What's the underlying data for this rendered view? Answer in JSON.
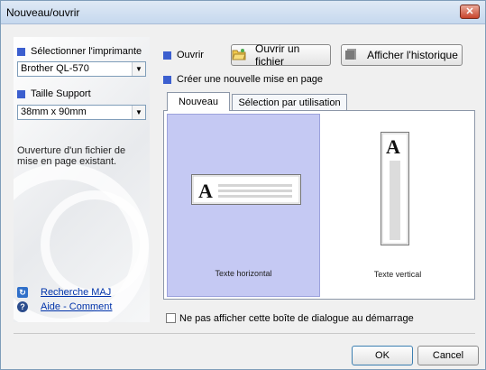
{
  "window": {
    "title": "Nouveau/ouvrir",
    "close_glyph": "✕"
  },
  "left": {
    "printer_label": "Sélectionner l'imprimante",
    "printer_value": "Brother QL-570",
    "media_label": "Taille Support",
    "media_value": "38mm x 90mm",
    "description": "Ouverture d'un fichier de mise en page existant.",
    "links": [
      {
        "label": "Recherche MAJ",
        "icon": "update-icon"
      },
      {
        "label": "Aide - Comment",
        "icon": "help-icon"
      }
    ]
  },
  "open": {
    "label": "Ouvrir",
    "open_file_button": "Ouvrir un fichier",
    "history_button": "Afficher l'historique"
  },
  "create": {
    "label": "Créer une nouvelle mise en page"
  },
  "tabs": [
    {
      "label": "Nouveau",
      "active": true
    },
    {
      "label": "Sélection par utilisation",
      "active": false
    }
  ],
  "layouts": {
    "horizontal_label": "Texte horizontal",
    "vertical_label": "Texte vertical",
    "letter": "A"
  },
  "startup_checkbox": {
    "label": "Ne pas afficher cette boîte de dialogue au démarrage",
    "checked": false
  },
  "footer": {
    "ok": "OK",
    "cancel": "Cancel"
  },
  "colors": {
    "accent_square": "#3c5fcf",
    "selected_option": "#c5c9f3",
    "link": "#0033aa"
  }
}
